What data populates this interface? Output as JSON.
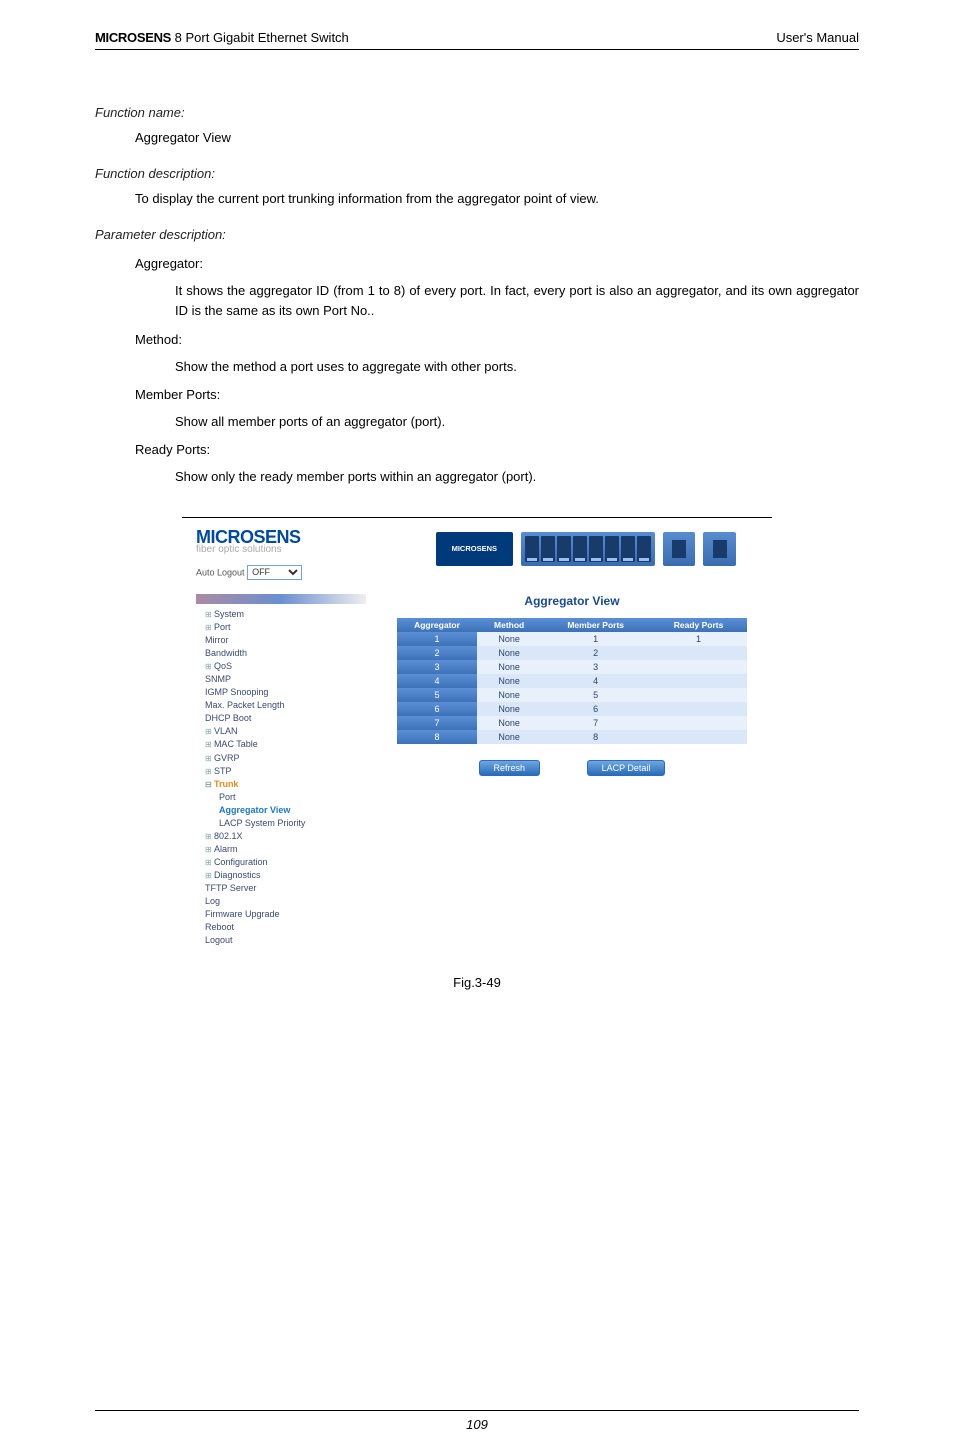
{
  "header": {
    "brand": "MICROSENS",
    "product": " 8 Port Gigabit Ethernet Switch",
    "right": "User's Manual"
  },
  "labels": {
    "fn_name": "Function name:",
    "fn_name_val": "Aggregator View",
    "fn_desc": "Function description:",
    "fn_desc_val": "To display the current port trunking information from the aggregator point of view.",
    "param_desc": "Parameter description:",
    "aggregator": "Aggregator:",
    "aggregator_txt": "It shows the aggregator ID (from 1 to 8) of every port. In fact, every port is also an aggregator, and its own aggregator ID is the same as its own Port No..",
    "method": "Method:",
    "method_txt": "Show the method a port uses to aggregate with other ports.",
    "member": "Member Ports:",
    "member_txt": "Show all member ports of an aggregator (port).",
    "ready": "Ready Ports:",
    "ready_txt": "Show only the ready member ports within an aggregator (port)."
  },
  "screenshot": {
    "logo_main": "MICROSENS",
    "logo_sub": "fiber optic solutions",
    "banner_brand": "MICROSENS",
    "auto_logout_label": "Auto Logout",
    "auto_logout_value": "OFF",
    "nav": [
      {
        "label": "System",
        "type": "col"
      },
      {
        "label": "Port",
        "type": "col"
      },
      {
        "label": "Mirror",
        "type": "leaf"
      },
      {
        "label": "Bandwidth",
        "type": "leaf"
      },
      {
        "label": "QoS",
        "type": "col"
      },
      {
        "label": "SNMP",
        "type": "leaf"
      },
      {
        "label": "IGMP Snooping",
        "type": "leaf"
      },
      {
        "label": "Max. Packet Length",
        "type": "leaf"
      },
      {
        "label": "DHCP Boot",
        "type": "leaf"
      },
      {
        "label": "VLAN",
        "type": "col"
      },
      {
        "label": "MAC Table",
        "type": "col"
      },
      {
        "label": "GVRP",
        "type": "col"
      },
      {
        "label": "STP",
        "type": "col"
      },
      {
        "label": "Trunk",
        "type": "exp",
        "sel": true,
        "children": [
          {
            "label": "Port",
            "type": "leaf"
          },
          {
            "label": "Aggregator View",
            "type": "leaf",
            "active": true
          },
          {
            "label": "LACP System Priority",
            "type": "leaf"
          }
        ]
      },
      {
        "label": "802.1X",
        "type": "col"
      },
      {
        "label": "Alarm",
        "type": "col"
      },
      {
        "label": "Configuration",
        "type": "col"
      },
      {
        "label": "Diagnostics",
        "type": "col"
      },
      {
        "label": "TFTP Server",
        "type": "leaf"
      },
      {
        "label": "Log",
        "type": "leaf"
      },
      {
        "label": "Firmware Upgrade",
        "type": "leaf"
      },
      {
        "label": "Reboot",
        "type": "leaf"
      },
      {
        "label": "Logout",
        "type": "leaf"
      }
    ],
    "content_title": "Aggregator View",
    "columns": [
      "Aggregator",
      "Method",
      "Member Ports",
      "Ready Ports"
    ],
    "rows": [
      {
        "agg": "1",
        "method": "None",
        "member": "1",
        "ready": "1"
      },
      {
        "agg": "2",
        "method": "None",
        "member": "2",
        "ready": ""
      },
      {
        "agg": "3",
        "method": "None",
        "member": "3",
        "ready": ""
      },
      {
        "agg": "4",
        "method": "None",
        "member": "4",
        "ready": ""
      },
      {
        "agg": "5",
        "method": "None",
        "member": "5",
        "ready": ""
      },
      {
        "agg": "6",
        "method": "None",
        "member": "6",
        "ready": ""
      },
      {
        "agg": "7",
        "method": "None",
        "member": "7",
        "ready": ""
      },
      {
        "agg": "8",
        "method": "None",
        "member": "8",
        "ready": ""
      }
    ],
    "buttons": {
      "refresh": "Refresh",
      "lacp_detail": "LACP Detail"
    }
  },
  "figure_caption": "Fig.3-49",
  "page_number": "109"
}
